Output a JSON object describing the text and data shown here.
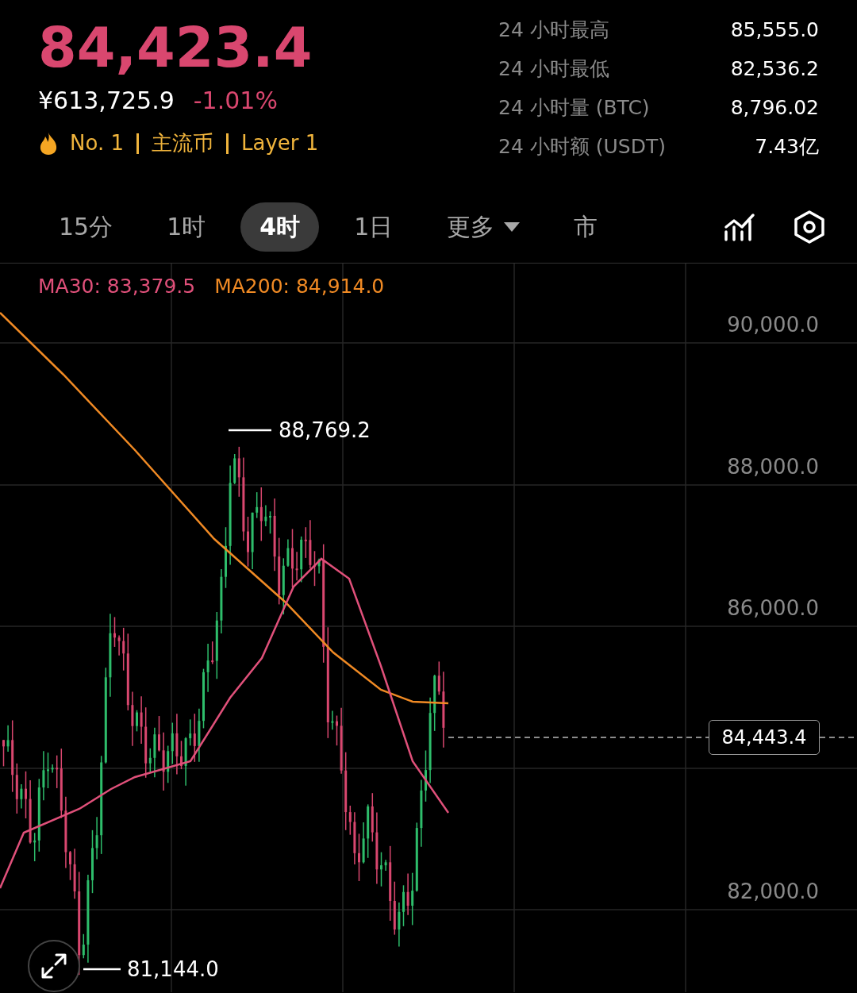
{
  "price": "84,423.4",
  "price_cny": "¥613,725.9",
  "change": "-1.01%",
  "tags": [
    "No. 1",
    "主流币",
    "Layer 1"
  ],
  "stats": [
    {
      "label": "24 小时最高",
      "value": "85,555.0"
    },
    {
      "label": "24 小时最低",
      "value": "82,536.2"
    },
    {
      "label": "24 小时量 (BTC)",
      "value": "8,796.02"
    },
    {
      "label": "24 小时额 (USDT)",
      "value": "7.43亿"
    }
  ],
  "timeframes": [
    {
      "label": "15分",
      "selected": false,
      "kind": "text"
    },
    {
      "label": "1时",
      "selected": false,
      "kind": "text"
    },
    {
      "label": "4时",
      "selected": true,
      "kind": "text"
    },
    {
      "label": "1日",
      "selected": false,
      "kind": "text"
    },
    {
      "label": "更多",
      "selected": false,
      "kind": "dropdown"
    },
    {
      "label": "市",
      "selected": false,
      "kind": "text"
    }
  ],
  "ma": [
    {
      "label": "MA30: 83,379.5",
      "color": "#e0507a"
    },
    {
      "label": "MA200: 84,914.0",
      "color": "#f08a24"
    }
  ],
  "chart": {
    "y_labels": [
      "90,000.0",
      "88,000.0",
      "86,000.0",
      "82,000.0"
    ],
    "high_label": "88,769.2",
    "low_label": "81,144.0",
    "last_price": "84,443.4"
  }
}
